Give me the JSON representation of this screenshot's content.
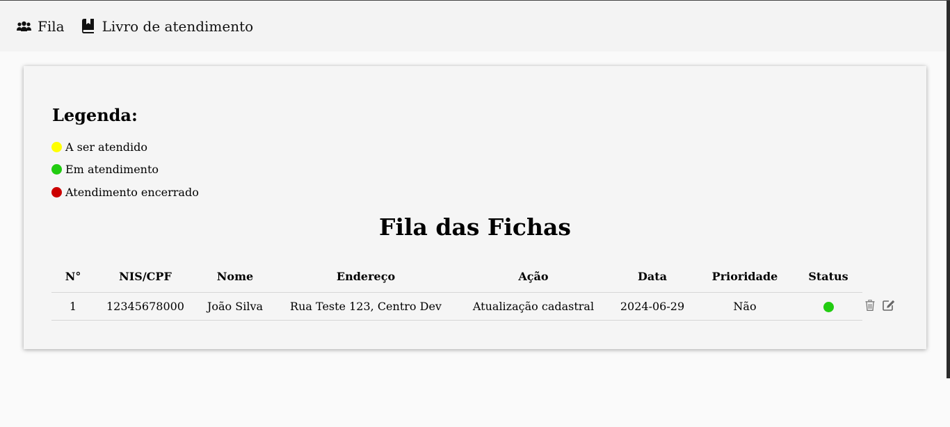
{
  "nav": {
    "items": [
      {
        "label": "Fila",
        "icon": "users-icon"
      },
      {
        "label": "Livro de atendimento",
        "icon": "book-bookmark-icon"
      }
    ]
  },
  "legend": {
    "title": "Legenda:",
    "items": [
      {
        "label": "A ser atendido",
        "color": "#ffff00"
      },
      {
        "label": "Em atendimento",
        "color": "#22cc11"
      },
      {
        "label": "Atendimento encerrado",
        "color": "#cc0000"
      }
    ]
  },
  "page_title": "Fila das Fichas",
  "table": {
    "headers": [
      "N°",
      "NIS/CPF",
      "Nome",
      "Endereço",
      "Ação",
      "Data",
      "Prioridade",
      "Status"
    ],
    "rows": [
      {
        "numero": "1",
        "nis_cpf": "12345678000",
        "nome": "João Silva",
        "endereco": "Rua Teste 123, Centro Dev",
        "acao": "Atualização cadastral",
        "data": "2024-06-29",
        "prioridade": "Não",
        "status": "Em atendimento",
        "status_color": "#22cc11",
        "actions": [
          "trash-icon",
          "edit-icon"
        ]
      }
    ]
  }
}
